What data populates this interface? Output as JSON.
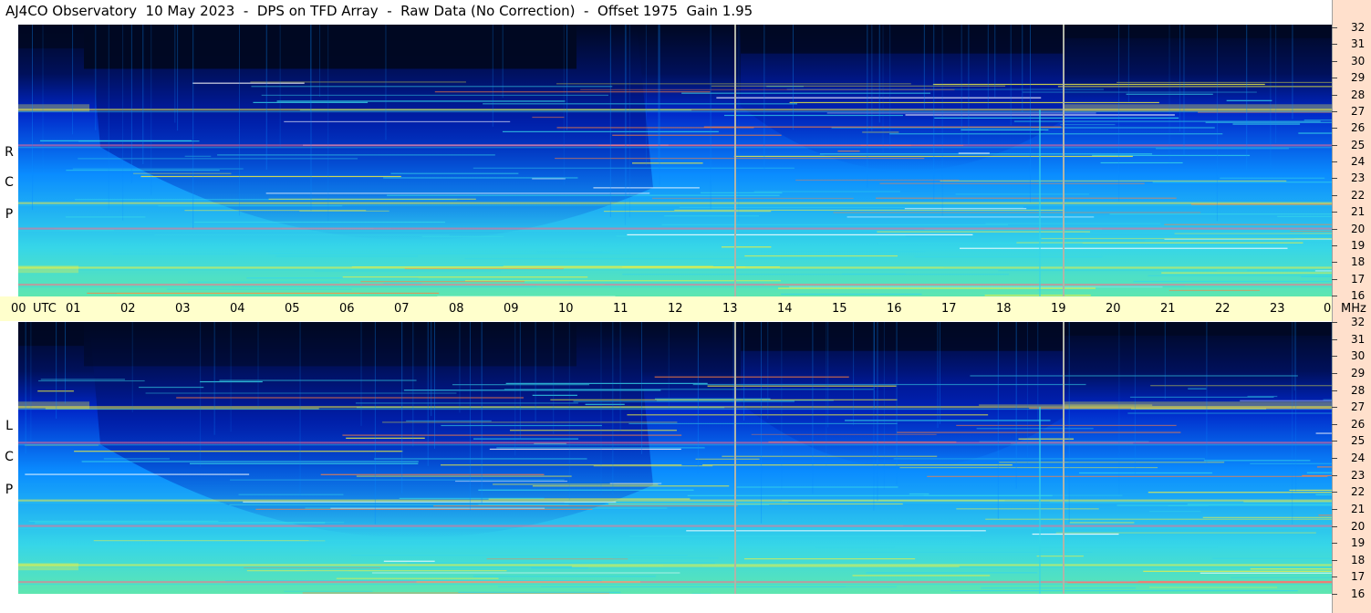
{
  "title": "AJ4CO Observatory  10 May 2023  -  DPS on TFD Array  -  Raw Data (No Correction)  -  Offset 1975  Gain 1.95",
  "panels": [
    {
      "label_letters": [
        "R",
        "C",
        "P"
      ]
    },
    {
      "label_letters": [
        "L",
        "C",
        "P"
      ]
    }
  ],
  "time_axis": {
    "unit_label": "UTC",
    "freq_unit_label": "MHz",
    "labels": [
      "00",
      "01",
      "02",
      "03",
      "04",
      "05",
      "06",
      "07",
      "08",
      "09",
      "10",
      "11",
      "12",
      "13",
      "14",
      "15",
      "16",
      "17",
      "18",
      "19",
      "20",
      "21",
      "22",
      "23",
      "00"
    ]
  },
  "freq_axis": {
    "labels": [
      "32",
      "31",
      "30",
      "29",
      "28",
      "27",
      "26",
      "25",
      "24",
      "23",
      "22",
      "21",
      "20",
      "19",
      "18",
      "17",
      "16"
    ]
  },
  "colors": {
    "background_night": "#000822",
    "low": "#0026c8",
    "mid": "#0a8cff",
    "high": "#36d6e8",
    "peak": "#f0f040",
    "axis_band": "#ffffcc",
    "right_axis": "#ffe0cc",
    "marker_line": "#b0b4a8"
  },
  "chart_data": {
    "type": "heatmap",
    "title": "AJ4CO Observatory  10 May 2023  -  DPS on TFD Array  -  Raw Data (No Correction)  -  Offset 1975  Gain 1.95",
    "x_axis": {
      "quantity": "time",
      "unit": "UTC",
      "range_hours": [
        0,
        24
      ],
      "ticks": [
        "00",
        "01",
        "02",
        "03",
        "04",
        "05",
        "06",
        "07",
        "08",
        "09",
        "10",
        "11",
        "12",
        "13",
        "14",
        "15",
        "16",
        "17",
        "18",
        "19",
        "20",
        "21",
        "22",
        "23",
        "00"
      ]
    },
    "y_axis": {
      "quantity": "frequency",
      "unit": "MHz",
      "range": [
        16,
        32
      ],
      "ticks": [
        16,
        17,
        18,
        19,
        20,
        21,
        22,
        23,
        24,
        25,
        26,
        27,
        28,
        29,
        30,
        31,
        32
      ]
    },
    "panels": [
      "RCP",
      "LCP"
    ],
    "vertical_marker_hours": [
      13.1,
      19.1
    ],
    "persistent_interference_mhz": [
      16.7,
      17.7,
      20.0,
      21.5,
      24.9,
      27.0
    ]
  }
}
